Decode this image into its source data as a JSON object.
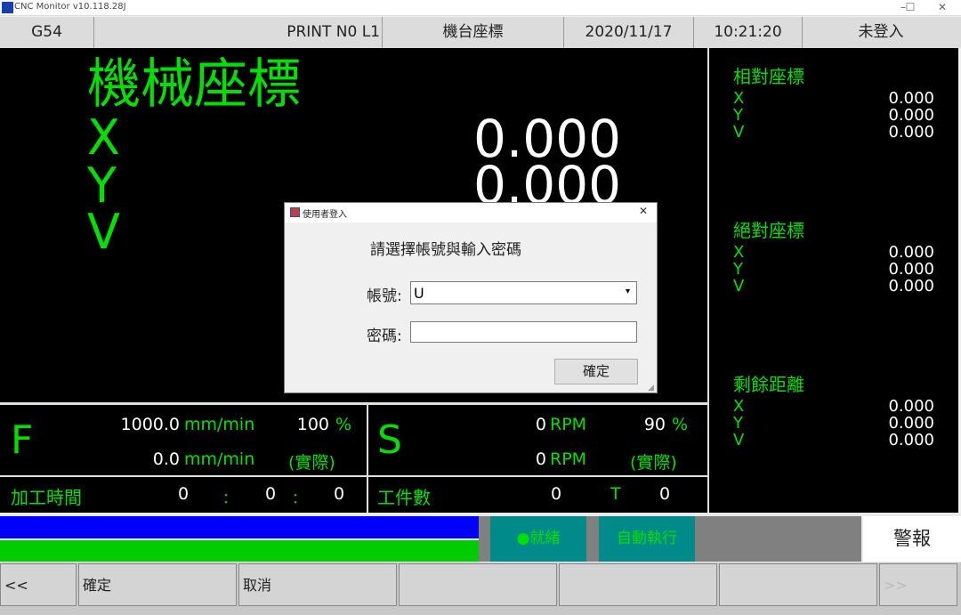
{
  "window": {
    "title": "CNC Monitor v10.118.28J",
    "min": "–",
    "max": "☐",
    "close": "✕"
  },
  "status": {
    "coord_sys": "G54",
    "program": "PRINT N0 L1",
    "mode": "機台座標",
    "date": "2020/11/17",
    "time": "10:21:20",
    "user": "未登入"
  },
  "main": {
    "title": "機械座標",
    "axes": [
      {
        "label": "X",
        "value": "0.000"
      },
      {
        "label": "Y",
        "value": "0.000"
      },
      {
        "label": "V",
        "value": ""
      }
    ]
  },
  "side": {
    "relative": {
      "title": "相對座標",
      "rows": [
        {
          "axis": "X",
          "value": "0.000"
        },
        {
          "axis": "Y",
          "value": "0.000"
        },
        {
          "axis": "V",
          "value": "0.000"
        }
      ]
    },
    "absolute": {
      "title": "絕對座標",
      "rows": [
        {
          "axis": "X",
          "value": "0.000"
        },
        {
          "axis": "Y",
          "value": "0.000"
        },
        {
          "axis": "V",
          "value": "0.000"
        }
      ]
    },
    "remaining": {
      "title": "剩餘距離",
      "rows": [
        {
          "axis": "X",
          "value": "0.000"
        },
        {
          "axis": "Y",
          "value": "0.000"
        },
        {
          "axis": "V",
          "value": "0.000"
        }
      ]
    }
  },
  "feed": {
    "label": "F",
    "cmd_value": "1000.0",
    "unit": "mm/min",
    "percent": "100",
    "pct_sign": "%",
    "act_value": "0.0",
    "actual_label": "(實際)"
  },
  "spindle": {
    "label": "S",
    "cmd_value": "0",
    "unit": "RPM",
    "percent": "90",
    "pct_sign": "%",
    "act_value": "0",
    "actual_label": "(實際)"
  },
  "machining_time": {
    "label": "加工時間",
    "h": "0",
    "m": "0",
    "s": "0",
    "sep": "："
  },
  "workpiece": {
    "label": "工件數",
    "count": "0",
    "t_label": "T",
    "t_value": "0"
  },
  "indicators": {
    "ready": "●就緒",
    "auto_run": "自動執行",
    "alarm": "警報"
  },
  "progress": {
    "blue_fraction": 1.0,
    "green_fraction": 1.0
  },
  "fkeys": [
    "<<",
    "確定",
    "取消",
    "",
    "",
    "",
    ">>"
  ],
  "dialog": {
    "title": "使用者登入",
    "close": "✕",
    "prompt": "請選擇帳號與輸入密碼",
    "account_label": "帳號:",
    "account_value": "U",
    "password_label": "密碼:",
    "password_value": "",
    "ok": "確定"
  },
  "colors": {
    "accent_green": "#00e000",
    "teal": "#008a8a",
    "blue_bar": "#0000ff",
    "green_bar": "#00cc00"
  }
}
